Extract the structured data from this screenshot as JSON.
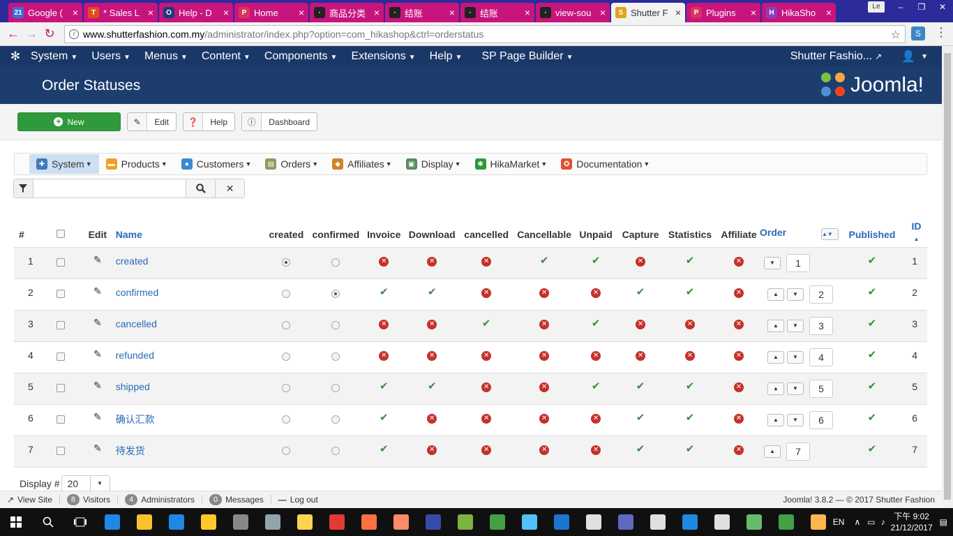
{
  "browser": {
    "tabs": [
      {
        "label": "Google (",
        "fav": "21",
        "fav_color": "#3b6fd8"
      },
      {
        "label": "* Sales L",
        "fav": "T",
        "fav_color": "#e04b1f"
      },
      {
        "label": "Help - D",
        "fav": "O",
        "fav_color": "#213a7a"
      },
      {
        "label": "Home",
        "fav": "P",
        "fav_color": "#d8335b"
      },
      {
        "label": "商品分类",
        "fav": "·",
        "fav_color": "#222222"
      },
      {
        "label": "结账",
        "fav": "·",
        "fav_color": "#222222"
      },
      {
        "label": "结账",
        "fav": "·",
        "fav_color": "#222222"
      },
      {
        "label": "view-sou",
        "fav": "·",
        "fav_color": "#222222"
      },
      {
        "label": "Shutter F",
        "fav": "S",
        "fav_color": "#e0a21f",
        "active": true
      },
      {
        "label": "Plugins",
        "fav": "P",
        "fav_color": "#d8335b"
      },
      {
        "label": "HikaSho",
        "fav": "H",
        "fav_color": "#8a3fbf"
      }
    ],
    "close_glyph": "×",
    "window_badge": "Le",
    "window_controls": [
      "–",
      "❐",
      "✕"
    ],
    "url_host": "www.shutterfashion.com.my",
    "url_path": "/administrator/index.php?option=com_hikashop&ctrl=orderstatus"
  },
  "joomla_nav": {
    "items": [
      "System",
      "Users",
      "Menus",
      "Content",
      "Components",
      "Extensions",
      "Help",
      "SP Page Builder"
    ],
    "site_name": "Shutter Fashio...",
    "brand_text": "Joomla!"
  },
  "page": {
    "title": "Order Statuses"
  },
  "toolbar": {
    "new_label": "New",
    "edit_label": "Edit",
    "help_label": "Help",
    "dashboard_label": "Dashboard"
  },
  "hika_menu": [
    {
      "label": "System",
      "icon": "wrench-icon",
      "color": "#3d7ab8",
      "selected": true
    },
    {
      "label": "Products",
      "icon": "box-icon",
      "color": "#f0a020"
    },
    {
      "label": "Customers",
      "icon": "users-icon",
      "color": "#3a8ad0"
    },
    {
      "label": "Orders",
      "icon": "clipboard-icon",
      "color": "#8a9a5a"
    },
    {
      "label": "Affiliates",
      "icon": "affiliate-icon",
      "color": "#d0802a"
    },
    {
      "label": "Display",
      "icon": "display-icon",
      "color": "#5a8a5a"
    },
    {
      "label": "HikaMarket",
      "icon": "hikamarket-icon",
      "color": "#2a9a3a"
    },
    {
      "label": "Documentation",
      "icon": "lifebuoy-icon",
      "color": "#e05030"
    }
  ],
  "filter": {
    "value": ""
  },
  "table": {
    "headers": {
      "num": "#",
      "edit": "Edit",
      "name": "Name",
      "created": "created",
      "confirmed": "confirmed",
      "invoice": "Invoice",
      "download": "Download",
      "cancelled": "cancelled",
      "cancellable": "Cancellable",
      "unpaid": "Unpaid",
      "capture": "Capture",
      "statistics": "Statistics",
      "affiliate": "Affiliate",
      "order": "Order",
      "published": "Published",
      "id": "ID"
    },
    "rows": [
      {
        "num": "1",
        "name": "created",
        "created": true,
        "confirmed": false,
        "flags": [
          false,
          false,
          false,
          true,
          true,
          false,
          true,
          false
        ],
        "order": "1",
        "up": false,
        "down": true,
        "published": true,
        "id": "1"
      },
      {
        "num": "2",
        "name": "confirmed",
        "created": false,
        "confirmed": true,
        "flags": [
          true,
          true,
          false,
          false,
          false,
          true,
          true,
          false
        ],
        "order": "2",
        "up": true,
        "down": true,
        "published": true,
        "id": "2"
      },
      {
        "num": "3",
        "name": "cancelled",
        "created": false,
        "confirmed": false,
        "flags": [
          false,
          false,
          true,
          false,
          true,
          false,
          false,
          false
        ],
        "order": "3",
        "up": true,
        "down": true,
        "published": true,
        "id": "3"
      },
      {
        "num": "4",
        "name": "refunded",
        "created": false,
        "confirmed": false,
        "flags": [
          false,
          false,
          false,
          false,
          false,
          false,
          false,
          false
        ],
        "order": "4",
        "up": true,
        "down": true,
        "published": true,
        "id": "4"
      },
      {
        "num": "5",
        "name": "shipped",
        "created": false,
        "confirmed": false,
        "flags": [
          true,
          true,
          false,
          false,
          true,
          true,
          true,
          false
        ],
        "order": "5",
        "up": true,
        "down": true,
        "published": true,
        "id": "5"
      },
      {
        "num": "6",
        "name": "确认汇款",
        "created": false,
        "confirmed": false,
        "flags": [
          true,
          false,
          false,
          false,
          false,
          true,
          true,
          false
        ],
        "order": "6",
        "up": true,
        "down": true,
        "published": true,
        "id": "6"
      },
      {
        "num": "7",
        "name": "待发货",
        "created": false,
        "confirmed": false,
        "flags": [
          true,
          false,
          false,
          false,
          false,
          true,
          true,
          false
        ],
        "order": "7",
        "up": true,
        "down": false,
        "published": true,
        "id": "7"
      }
    ]
  },
  "display": {
    "label": "Display #",
    "value": "20"
  },
  "statusbar": {
    "view_site": "View Site",
    "visitors_count": "8",
    "visitors_label": "Visitors",
    "admins_count": "4",
    "admins_label": "Administrators",
    "messages_count": "0",
    "messages_label": "Messages",
    "logout_label": "Log out",
    "copyright": "Joomla! 3.8.2 — © 2017 Shutter Fashion"
  },
  "taskbar": {
    "lang": "EN",
    "time": "下午 9:02",
    "date": "21/12/2017",
    "apps": [
      "#1e88e5",
      "#fbc02d",
      "#1e88e5",
      "#ffca28",
      "#888888",
      "#90a4ae",
      "#ffd54f",
      "#e53935",
      "#ff7043",
      "#ff8a65",
      "#3949ab",
      "#7cb342",
      "#43a047",
      "#4fc3f7",
      "#1976d2",
      "#e0e0e0",
      "#5c6bc0",
      "#e0e0e0",
      "#1e88e5",
      "#e0e0e0",
      "#66bb6a",
      "#43a047",
      "#ffb74d"
    ]
  }
}
